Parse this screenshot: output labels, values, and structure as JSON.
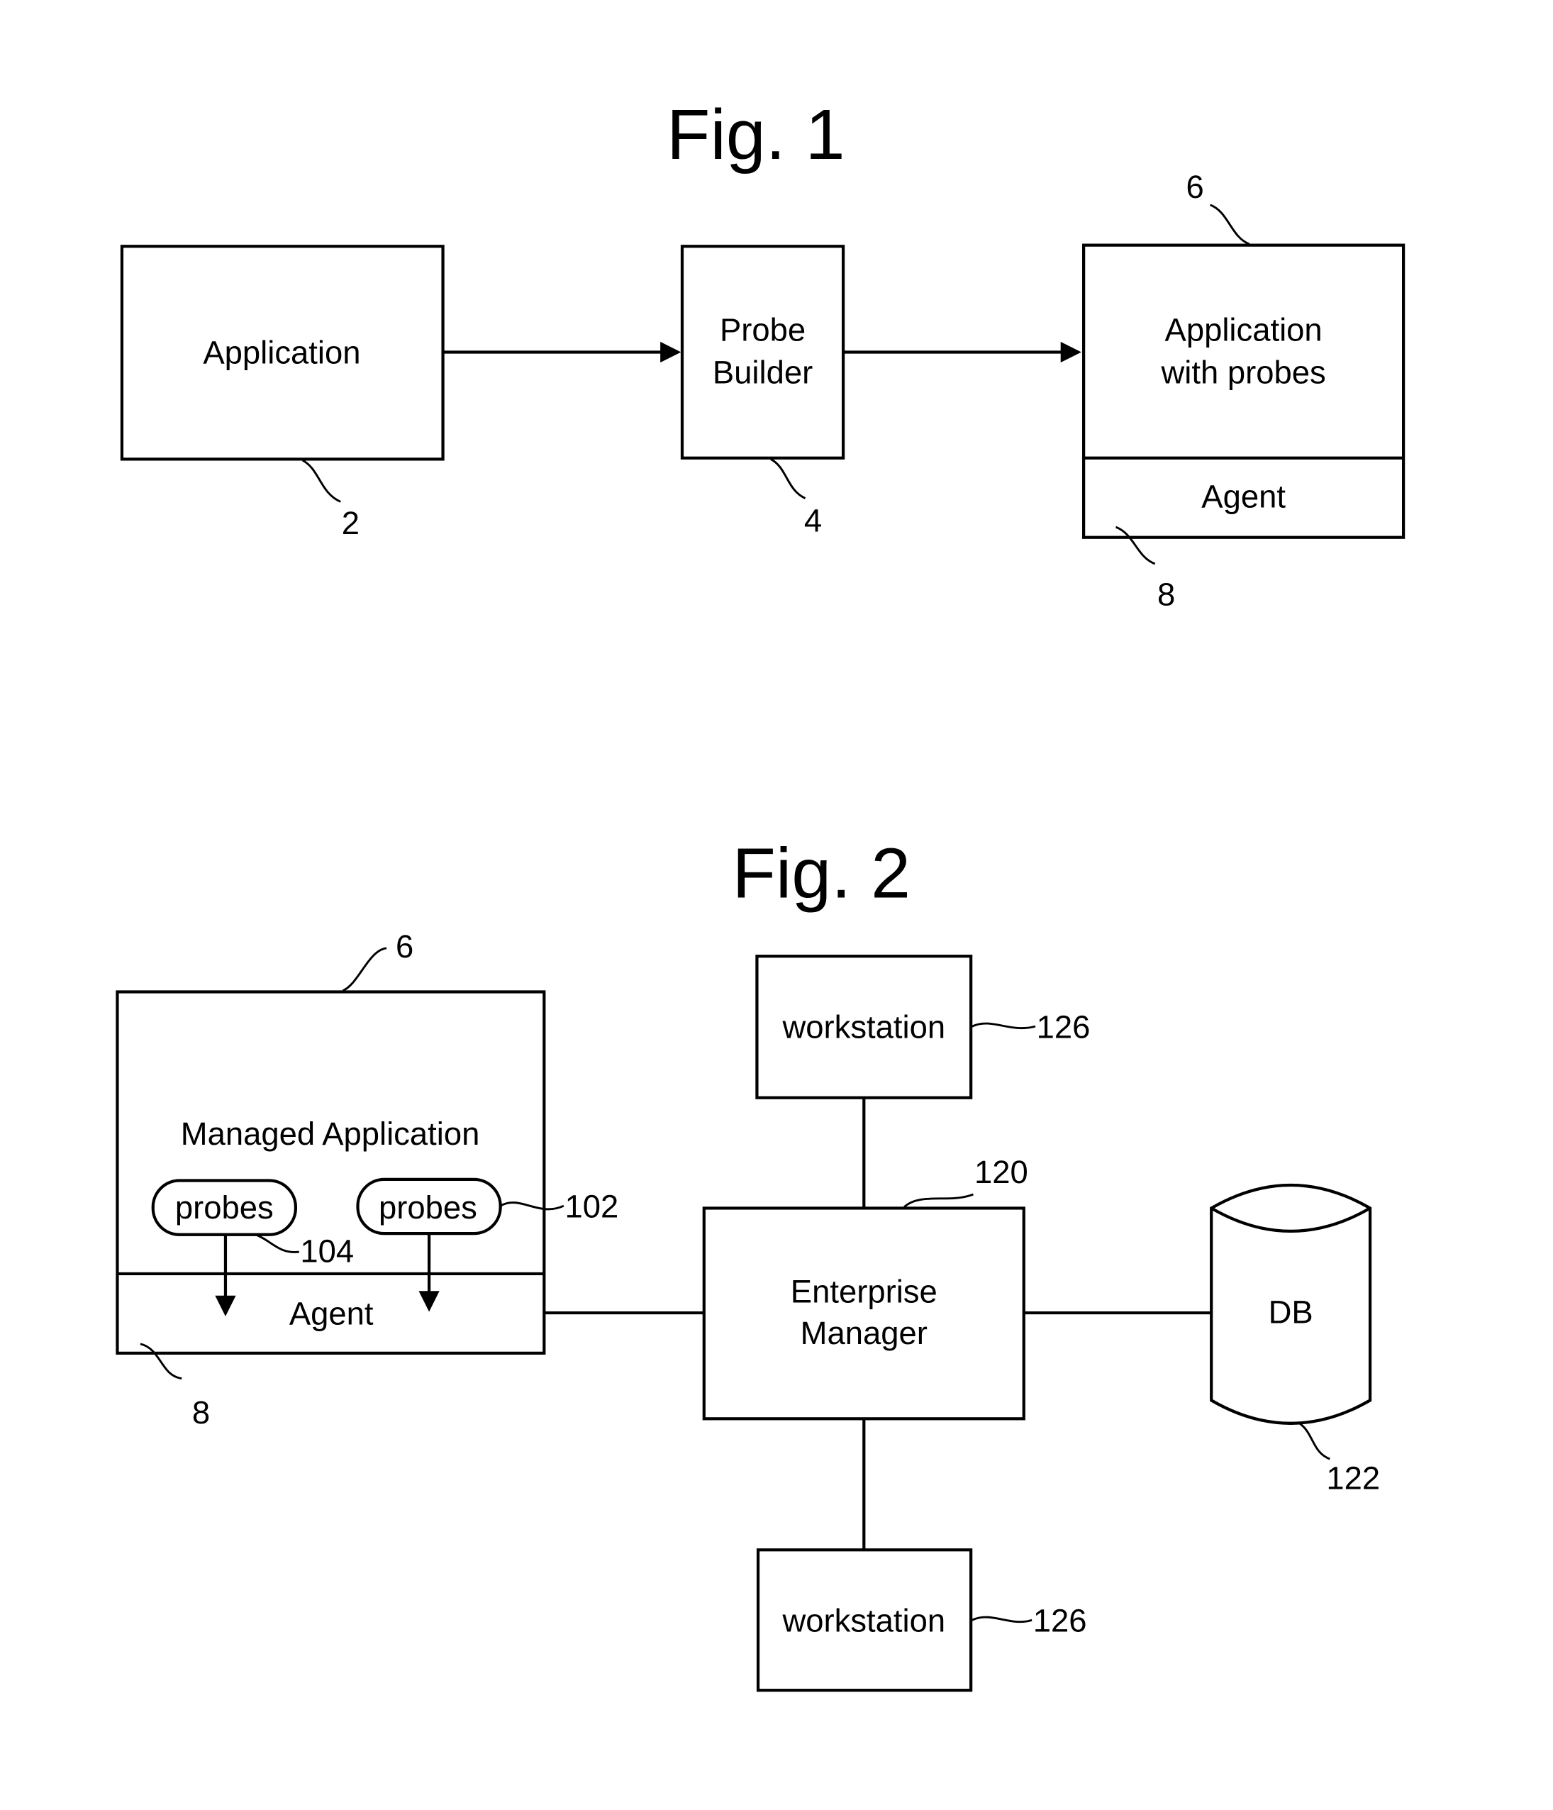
{
  "fig1": {
    "title": "Fig. 1",
    "application": {
      "label": "Application",
      "ref": "2"
    },
    "probe_builder": {
      "line1": "Probe",
      "line2": "Builder",
      "ref": "4"
    },
    "app_with_probes": {
      "line1": "Application",
      "line2": "with probes",
      "ref": "6"
    },
    "agent": {
      "label": "Agent",
      "ref": "8"
    }
  },
  "fig2": {
    "title": "Fig. 2",
    "managed_app": {
      "label": "Managed Application",
      "ref": "6"
    },
    "probes_left": {
      "label": "probes",
      "ref": "104"
    },
    "probes_right": {
      "label": "probes",
      "ref": "102"
    },
    "agent": {
      "label": "Agent",
      "ref": "8"
    },
    "enterprise_manager": {
      "line1": "Enterprise",
      "line2": "Manager",
      "ref": "120"
    },
    "db": {
      "label": "DB",
      "ref": "122"
    },
    "workstation_top": {
      "label": "workstation",
      "ref": "126"
    },
    "workstation_bottom": {
      "label": "workstation",
      "ref": "126"
    }
  }
}
